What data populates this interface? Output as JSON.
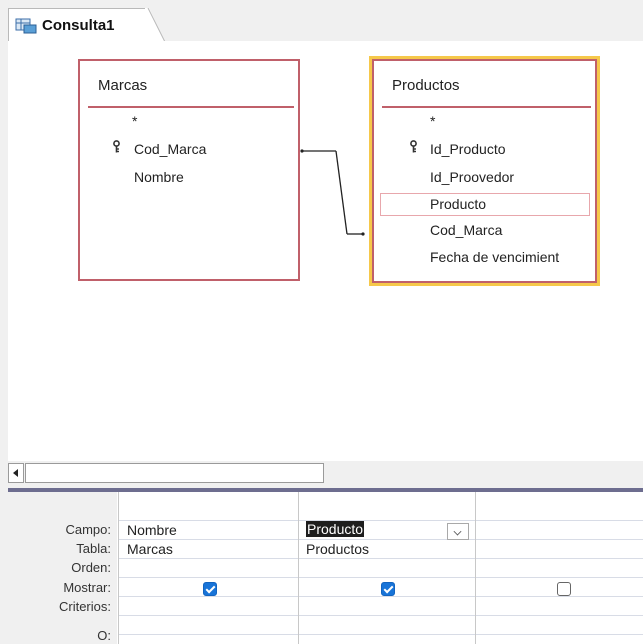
{
  "tab": {
    "title": "Consulta1",
    "icon": "query-icon"
  },
  "tables": {
    "marcas": {
      "title": "Marcas",
      "fields": [
        {
          "name": "*",
          "key": false
        },
        {
          "name": "Cod_Marca",
          "key": true
        },
        {
          "name": "Nombre",
          "key": false
        }
      ]
    },
    "productos": {
      "title": "Productos",
      "selected": true,
      "fields": [
        {
          "name": "*",
          "key": false
        },
        {
          "name": "Id_Producto",
          "key": true
        },
        {
          "name": "Id_Proovedor",
          "key": false
        },
        {
          "name": "Producto",
          "key": false,
          "selected": true
        },
        {
          "name": "Cod_Marca",
          "key": false
        },
        {
          "name": "Fecha de vencimient",
          "key": false
        }
      ]
    }
  },
  "grid": {
    "row_labels": [
      "Campo:",
      "Tabla:",
      "Orden:",
      "Mostrar:",
      "Criterios:",
      "O:"
    ],
    "columns": [
      {
        "campo": "Nombre",
        "tabla": "Marcas",
        "mostrar": true
      },
      {
        "campo": "Producto",
        "tabla": "Productos",
        "mostrar": true,
        "active": true
      },
      {
        "campo": "",
        "tabla": "",
        "mostrar": false
      }
    ]
  },
  "colors": {
    "table_border": "#c0606a",
    "selected_outline": "#f6c84a",
    "checkbox_on": "#1874d8",
    "splitter": "#6d6d8f"
  }
}
